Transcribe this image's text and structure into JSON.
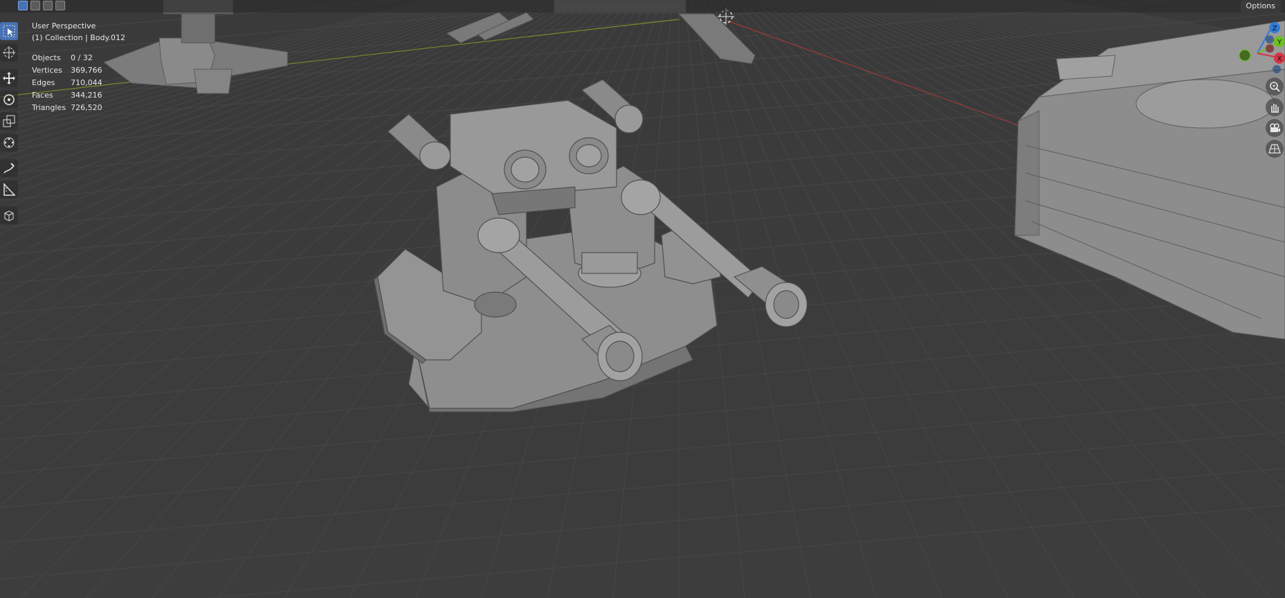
{
  "viewport": {
    "view_name": "User Perspective",
    "collection_line": "(1) Collection | Body.012",
    "options_label": "Options"
  },
  "stats": [
    {
      "label": "Objects",
      "value": "0 / 32"
    },
    {
      "label": "Vertices",
      "value": "369,766"
    },
    {
      "label": "Edges",
      "value": "710,044"
    },
    {
      "label": "Faces",
      "value": "344,216"
    },
    {
      "label": "Triangles",
      "value": "726,520"
    }
  ],
  "header_mode_icons": [
    "select-box-icon",
    "select-extend-icon",
    "select-subtract-icon",
    "select-invert-icon"
  ],
  "tools": [
    {
      "name": "select-box-icon",
      "active": true
    },
    {
      "name": "cursor-icon",
      "active": false
    },
    {
      "name": "move-icon",
      "active": false
    },
    {
      "name": "rotate-icon",
      "active": false
    },
    {
      "name": "scale-icon",
      "active": false
    },
    {
      "name": "transform-icon",
      "active": false
    },
    {
      "name": "annotate-icon",
      "active": false
    },
    {
      "name": "measure-icon",
      "active": false
    },
    {
      "name": "add-cube-icon",
      "active": false
    }
  ],
  "gizmo": {
    "axes": [
      {
        "label": "Z",
        "color": "#2f7bd9"
      },
      {
        "label": "Y",
        "color": "#6bbf22"
      },
      {
        "label": "X",
        "color": "#d93245"
      }
    ]
  },
  "nav_buttons": [
    "zoom-icon",
    "pan-hand-icon",
    "camera-icon",
    "perspective-grid-icon"
  ],
  "colors": {
    "background": "#3b3b3b",
    "grid": "#474747",
    "x_axis": "#9d3a3a",
    "y_axis": "#7a8b2a",
    "accent": "#4772b3",
    "model": "#8d8d8d"
  }
}
